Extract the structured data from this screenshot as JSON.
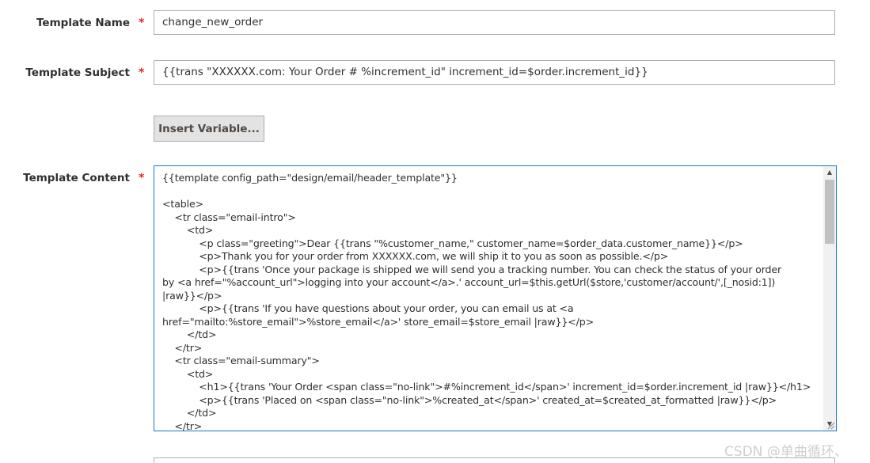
{
  "fields": {
    "template_name": {
      "label": "Template Name",
      "required_mark": "*",
      "value": "change_new_order"
    },
    "template_subject": {
      "label": "Template Subject",
      "required_mark": "*",
      "value": "{{trans \"XXXXXX.com: Your Order # %increment_id\" increment_id=$order.increment_id}}"
    },
    "insert_variable": {
      "label": "Insert Variable..."
    },
    "template_content": {
      "label": "Template Content",
      "required_mark": "*",
      "lines": [
        "{{template config_path=\"design/email/header_template\"}}",
        "",
        "<table>",
        "    <tr class=\"email-intro\">",
        "        <td>",
        "            <p class=\"greeting\">Dear {{trans \"%customer_name,\" customer_name=$order_data.customer_name}}</p>",
        "            <p>Thank you for your order from XXXXXX.com, we will ship it to you as soon as possible.</p>",
        "            <p>{{trans 'Once your package is shipped we will send you a tracking number. You can check the status of your order",
        "by <a href=\"%account_url\">logging into your account</a>.' account_url=$this.getUrl($store,'customer/account/',[_nosid:1])",
        "|raw}}</p>",
        "            <p>{{trans 'If you have questions about your order, you can email us at <a",
        "href=\"mailto:%store_email\">%store_email</a>' store_email=$store_email |raw}}</p>",
        "        </td>",
        "    </tr>",
        "    <tr class=\"email-summary\">",
        "        <td>",
        "            <h1>{{trans 'Your Order <span class=\"no-link\">#%increment_id</span>' increment_id=$order.increment_id |raw}}</h1>",
        "            <p>{{trans 'Placed on <span class=\"no-link\">%created_at</span>' created_at=$created_at_formatted |raw}}</p>",
        "        </td>",
        "    </tr>"
      ]
    }
  },
  "watermark": "CSDN @单曲循环、",
  "colors": {
    "required": "#e22626",
    "focus_border": "#1979c3",
    "button_bg": "#e3e3e3",
    "input_border": "#adadad"
  }
}
